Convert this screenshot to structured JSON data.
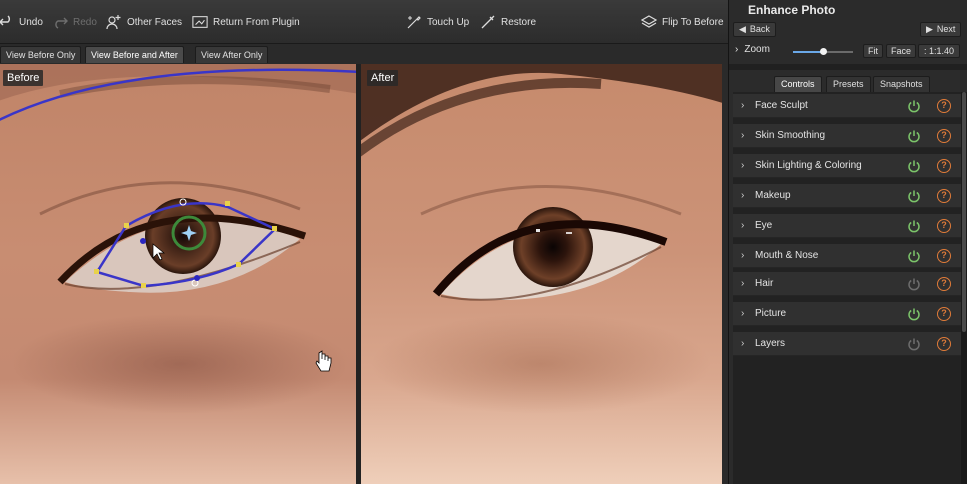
{
  "toolbar": {
    "undo": "Undo",
    "redo": "Redo",
    "other_faces": "Other Faces",
    "return_from_plugin": "Return From Plugin",
    "touch_up": "Touch Up",
    "restore": "Restore",
    "flip_to_before": "Flip To Before"
  },
  "view_tabs": [
    "View Before Only",
    "View Before and After",
    "View After Only"
  ],
  "active_view": "View Before and After",
  "panels": {
    "before_label": "Before",
    "after_label": "After"
  },
  "right_panel": {
    "title": "Enhance Photo",
    "back": "Back",
    "next": "Next",
    "zoom_label": "Zoom",
    "zoom_level": 0.5,
    "fit": "Fit",
    "face": "Face",
    "zoom_ratio": "1:1.40",
    "tabs": [
      "Controls",
      "Presets",
      "Snapshots"
    ],
    "active_tab": "Controls",
    "items": [
      {
        "label": "Face Sculpt",
        "enabled": true
      },
      {
        "label": "Skin Smoothing",
        "enabled": true
      },
      {
        "label": "Skin Lighting & Coloring",
        "enabled": true
      },
      {
        "label": "Makeup",
        "enabled": true
      },
      {
        "label": "Eye",
        "enabled": true
      },
      {
        "label": "Mouth & Nose",
        "enabled": true
      },
      {
        "label": "Hair",
        "enabled": false
      },
      {
        "label": "Picture",
        "enabled": true
      },
      {
        "label": "Layers",
        "enabled": false
      }
    ]
  },
  "colors": {
    "power_on": "#7cc46a",
    "power_off": "#6d6d6d",
    "help": "#e07b39",
    "overlay": "#3a35c8"
  }
}
